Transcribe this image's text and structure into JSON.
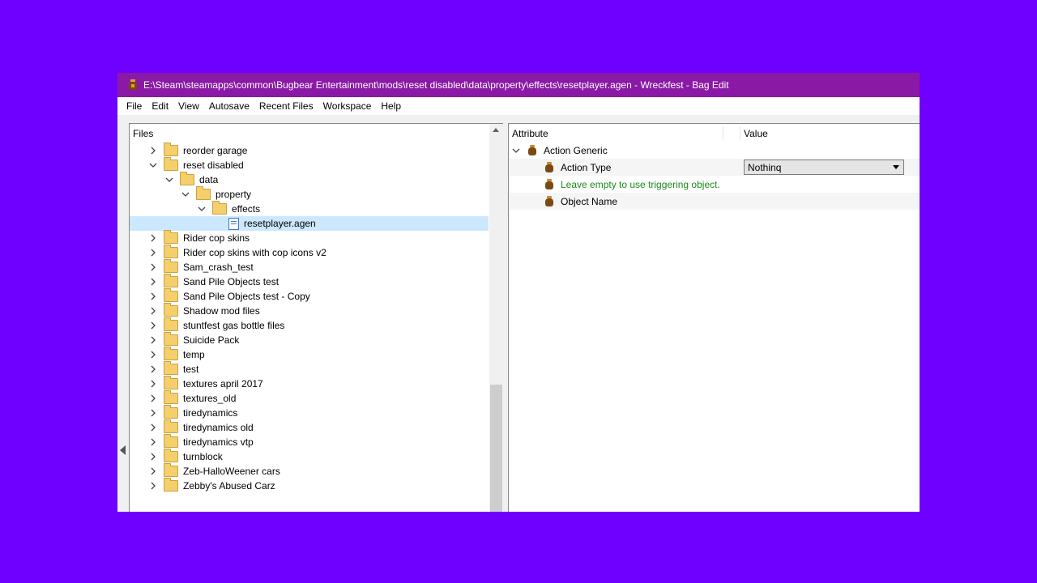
{
  "window": {
    "title": "E:\\Steam\\steamapps\\common\\Bugbear Entertainment\\mods\\reset disabled\\data\\property\\effects\\resetplayer.agen - Wreckfest - Bag Edit"
  },
  "menu": [
    "File",
    "Edit",
    "View",
    "Autosave",
    "Recent Files",
    "Workspace",
    "Help"
  ],
  "files_pane": {
    "title": "Files",
    "items": [
      {
        "label": "reorder garage",
        "depth": 0,
        "expand": "collapsed",
        "type": "folder",
        "selected": false
      },
      {
        "label": "reset disabled",
        "depth": 0,
        "expand": "expanded",
        "type": "folder",
        "selected": false
      },
      {
        "label": "data",
        "depth": 1,
        "expand": "expanded",
        "type": "folder",
        "selected": false
      },
      {
        "label": "property",
        "depth": 2,
        "expand": "expanded",
        "type": "folder",
        "selected": false
      },
      {
        "label": "effects",
        "depth": 3,
        "expand": "expanded",
        "type": "folder",
        "selected": false
      },
      {
        "label": "resetplayer.agen",
        "depth": 4,
        "expand": "none",
        "type": "file",
        "selected": true
      },
      {
        "label": "Rider cop skins",
        "depth": 0,
        "expand": "collapsed",
        "type": "folder",
        "selected": false
      },
      {
        "label": "Rider cop skins with cop icons v2",
        "depth": 0,
        "expand": "collapsed",
        "type": "folder",
        "selected": false
      },
      {
        "label": "Sam_crash_test",
        "depth": 0,
        "expand": "collapsed",
        "type": "folder",
        "selected": false
      },
      {
        "label": "Sand Pile Objects test",
        "depth": 0,
        "expand": "collapsed",
        "type": "folder",
        "selected": false
      },
      {
        "label": "Sand Pile Objects test - Copy",
        "depth": 0,
        "expand": "collapsed",
        "type": "folder",
        "selected": false
      },
      {
        "label": "Shadow mod files",
        "depth": 0,
        "expand": "collapsed",
        "type": "folder",
        "selected": false
      },
      {
        "label": "stuntfest gas bottle files",
        "depth": 0,
        "expand": "collapsed",
        "type": "folder",
        "selected": false
      },
      {
        "label": "Suicide Pack",
        "depth": 0,
        "expand": "collapsed",
        "type": "folder",
        "selected": false
      },
      {
        "label": "temp",
        "depth": 0,
        "expand": "collapsed",
        "type": "folder",
        "selected": false
      },
      {
        "label": "test",
        "depth": 0,
        "expand": "collapsed",
        "type": "folder",
        "selected": false
      },
      {
        "label": "textures april 2017",
        "depth": 0,
        "expand": "collapsed",
        "type": "folder",
        "selected": false
      },
      {
        "label": "textures_old",
        "depth": 0,
        "expand": "collapsed",
        "type": "folder",
        "selected": false
      },
      {
        "label": "tiredynamics",
        "depth": 0,
        "expand": "collapsed",
        "type": "folder",
        "selected": false
      },
      {
        "label": "tiredynamics old",
        "depth": 0,
        "expand": "collapsed",
        "type": "folder",
        "selected": false
      },
      {
        "label": "tiredynamics vtp",
        "depth": 0,
        "expand": "collapsed",
        "type": "folder",
        "selected": false
      },
      {
        "label": "turnblock",
        "depth": 0,
        "expand": "collapsed",
        "type": "folder",
        "selected": false
      },
      {
        "label": "Zeb-HalloWeener cars",
        "depth": 0,
        "expand": "collapsed",
        "type": "folder",
        "selected": false
      },
      {
        "label": "Zebby's Abused Carz",
        "depth": 0,
        "expand": "collapsed",
        "type": "folder",
        "selected": false
      }
    ]
  },
  "attributes_pane": {
    "columns": {
      "attribute": "Attribute",
      "value": "Value"
    },
    "root": {
      "label": "Action Generic"
    },
    "action_type": {
      "label": "Action Type",
      "value": "Nothinq"
    },
    "hint": "Leave empty to use triggering object.",
    "object_name": {
      "label": "Object Name"
    }
  },
  "colors": {
    "desktop": "#6f00ff",
    "titlebar": "#8a19a5",
    "selection": "#cce8ff",
    "hint_text": "#1a8a1a"
  }
}
